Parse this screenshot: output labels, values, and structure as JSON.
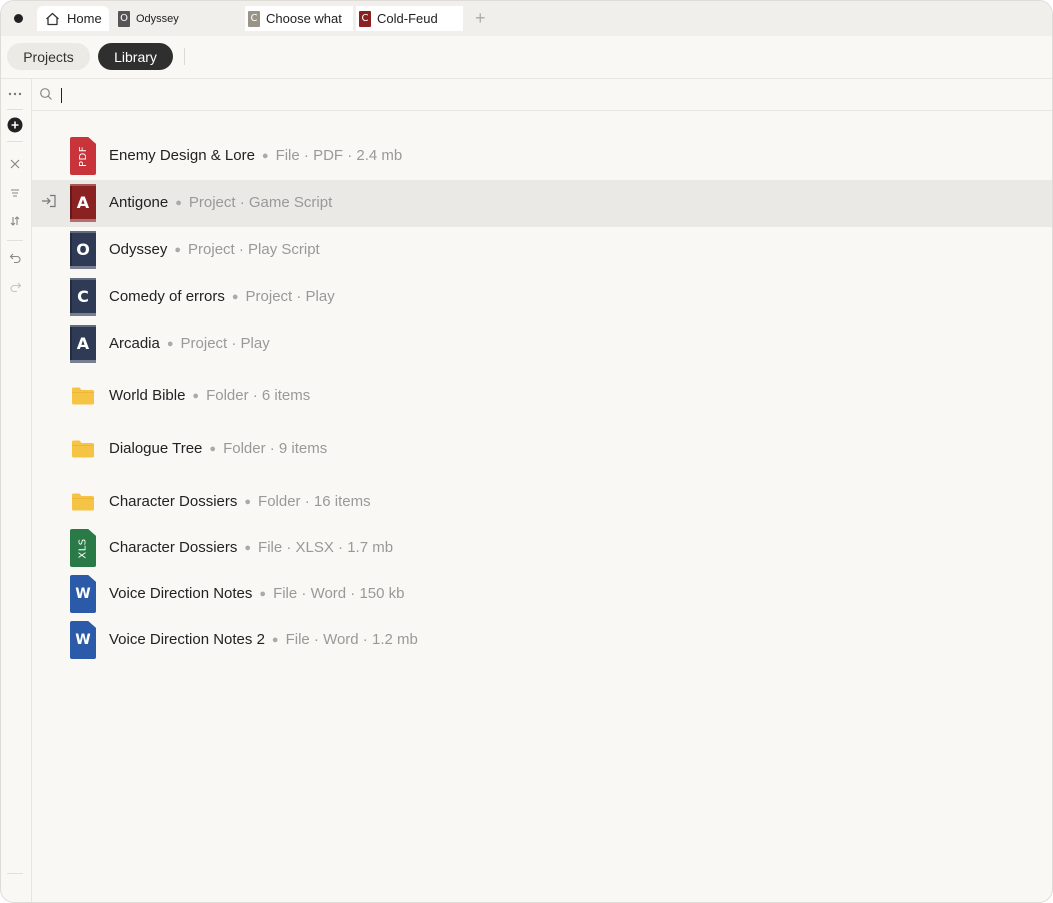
{
  "tabs": {
    "home": "Home",
    "odyssey": {
      "label": "Odyssey",
      "icon_letter": "O"
    },
    "choose": {
      "label": "Choose what",
      "icon_letter": "C"
    },
    "cold": {
      "label": "Cold-Feud",
      "icon_letter": "C"
    }
  },
  "pills": {
    "projects": "Projects",
    "library": "Library"
  },
  "search": {
    "value": ""
  },
  "colors": {
    "pdf": "#c8343a",
    "project_red": "#8a2222",
    "project_navy": "#2f3a54",
    "folder": "#f6c445",
    "xls": "#2a7a47",
    "word": "#2a5aa8"
  },
  "items": [
    {
      "icon": "pdf-file-icon",
      "icon_text": "PDF",
      "name": "Enemy Design & Lore",
      "meta": "File · PDF · 2.4 mb"
    },
    {
      "icon": "project-book-icon",
      "icon_text": "A",
      "name": "Antigone",
      "meta": "Project · Game Script",
      "selected": true
    },
    {
      "icon": "project-book-icon",
      "icon_text": "O",
      "name": "Odyssey",
      "meta": "Project · Play Script"
    },
    {
      "icon": "project-book-icon",
      "icon_text": "C",
      "name": "Comedy of errors",
      "meta": "Project · Play"
    },
    {
      "icon": "project-book-icon",
      "icon_text": "A",
      "name": "Arcadia",
      "meta": "Project · Play"
    },
    {
      "icon": "folder-icon",
      "name": "World Bible",
      "meta": "Folder · 6 items"
    },
    {
      "icon": "folder-icon",
      "name": "Dialogue Tree",
      "meta": "Folder · 9 items"
    },
    {
      "icon": "folder-icon",
      "name": "Character Dossiers",
      "meta": "Folder · 16 items"
    },
    {
      "icon": "xls-file-icon",
      "icon_text": "XLS",
      "name": "Character Dossiers",
      "meta": "File · XLSX · 1.7 mb"
    },
    {
      "icon": "word-file-icon",
      "icon_text": "W",
      "name": "Voice Direction Notes",
      "meta": "File · Word · 150 kb"
    },
    {
      "icon": "word-file-icon",
      "icon_text": "W",
      "name": "Voice Direction Notes 2",
      "meta": "File · Word · 1.2 mb"
    }
  ]
}
